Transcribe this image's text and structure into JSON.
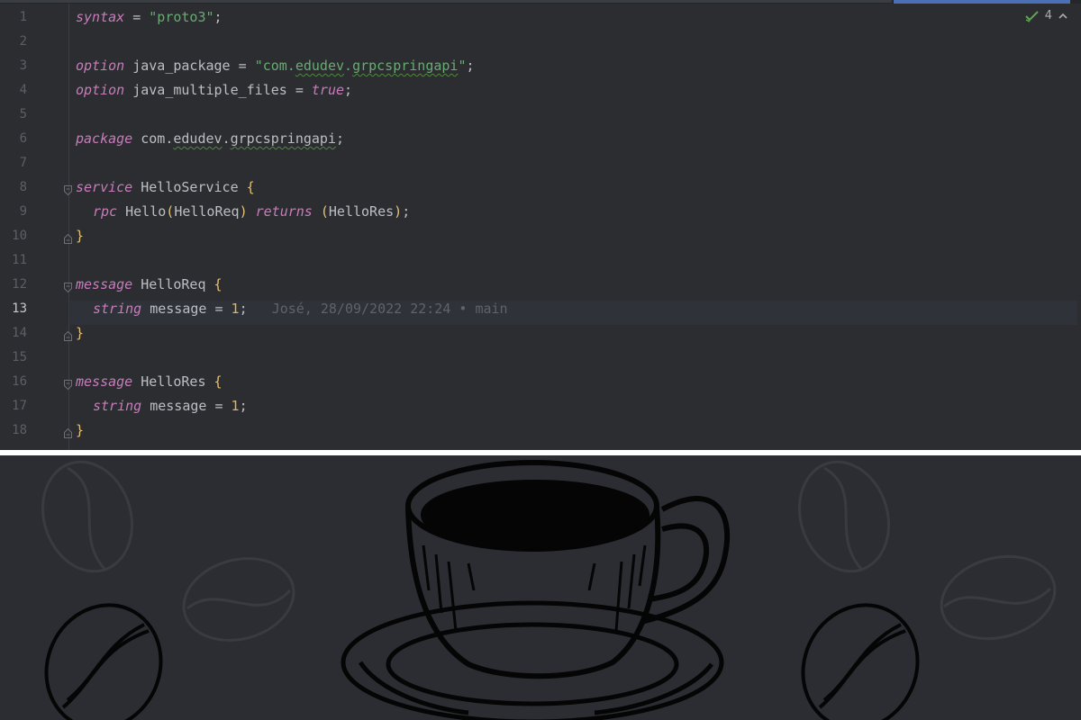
{
  "editor": {
    "inspection_count": "4",
    "active_line": "13",
    "line_numbers": [
      "1",
      "2",
      "3",
      "4",
      "5",
      "6",
      "7",
      "8",
      "9",
      "10",
      "11",
      "12",
      "13",
      "14",
      "15",
      "16",
      "17",
      "18"
    ],
    "code": {
      "l1_kw": "syntax",
      "l1_eq": " = ",
      "l1_str": "\"proto3\"",
      "l1_end": ";",
      "l3_kw": "option",
      "l3_name": " java_package = ",
      "l3_str_a": "\"com.",
      "l3_str_b": "edudev",
      "l3_str_c": ".",
      "l3_str_d": "grpcspringapi",
      "l3_str_e": "\"",
      "l3_end": ";",
      "l4_kw": "option",
      "l4_name": " java_multiple_files = ",
      "l4_val": "true",
      "l4_end": ";",
      "l6_kw": "package",
      "l6_a": " com.",
      "l6_b": "edudev",
      "l6_c": ".",
      "l6_d": "grpcspringapi",
      "l6_end": ";",
      "l8_kw": "service",
      "l8_name": " HelloService ",
      "l8_brace": "{",
      "l9_kw": "rpc",
      "l9_a": " Hello",
      "l9_p1": "(",
      "l9_b": "HelloReq",
      "l9_p2": ")",
      "l9_kw2": "returns",
      "l9_p3": "(",
      "l9_c": "HelloRes",
      "l9_p4": ")",
      "l9_end": ";",
      "l10_brace": "}",
      "l12_kw": "message",
      "l12_name": " HelloReq ",
      "l12_brace": "{",
      "l13_kw": "string",
      "l13_a": " message = ",
      "l13_num": "1",
      "l13_end": ";",
      "l13_blame": "José, 28/09/2022 22:24 • main",
      "l14_brace": "}",
      "l16_kw": "message",
      "l16_name": " HelloRes ",
      "l16_brace": "{",
      "l17_kw": "string",
      "l17_a": " message = ",
      "l17_num": "1",
      "l17_end": ";",
      "l18_brace": "}"
    }
  },
  "colors": {
    "keyword": "#c77dbb",
    "string": "#6aab73",
    "number": "#e8b35a",
    "brace": "#e5c07b",
    "background": "#2b2d30"
  },
  "icons": {
    "inspection": "check-icon",
    "collapse": "chevron-up-icon"
  }
}
